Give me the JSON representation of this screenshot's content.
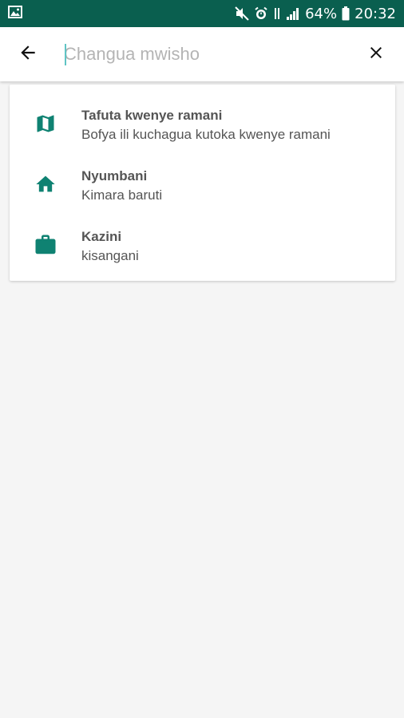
{
  "status_bar": {
    "battery": "64%",
    "time": "20:32",
    "icons": [
      "image-notification-icon",
      "mute-icon",
      "alarm-icon",
      "data-transfer-icon",
      "signal-icon",
      "battery-icon"
    ]
  },
  "search": {
    "placeholder": "Changua mwisho",
    "value": "",
    "back_icon": "arrow-left-icon",
    "clear_icon": "close-icon"
  },
  "suggestions": [
    {
      "icon": "map-icon",
      "title": "Tafuta kwenye ramani",
      "subtitle": "Bofya ili kuchagua kutoka kwenye ramani"
    },
    {
      "icon": "home-icon",
      "title": "Nyumbani",
      "subtitle": "Kimara baruti"
    },
    {
      "icon": "briefcase-icon",
      "title": "Kazini",
      "subtitle": "kisangani"
    }
  ],
  "colors": {
    "status_bar": "#0a5f4f",
    "accent_icon": "#0f8272",
    "background": "#f5f5f5"
  }
}
